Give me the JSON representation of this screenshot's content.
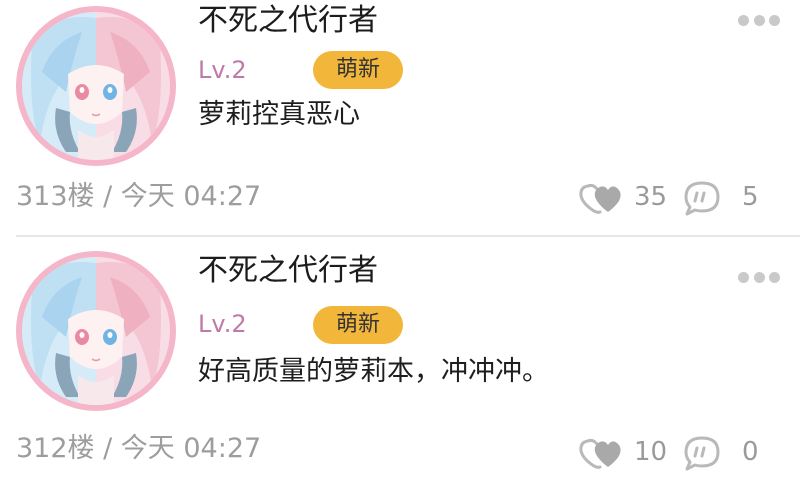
{
  "comments": [
    {
      "username": "不死之代行者",
      "level": "Lv.2",
      "badge": "萌新",
      "text": "萝莉控真恶心",
      "floor_time": "313楼 / 今天 04:27",
      "likes": "35",
      "replies": "5"
    },
    {
      "username": "不死之代行者",
      "level": "Lv.2",
      "badge": "萌新",
      "text": "好高质量的萝莉本，冲冲冲。",
      "floor_time": "312楼 / 今天 04:27",
      "likes": "10",
      "replies": "0"
    }
  ],
  "icons": {
    "like": "heart-like-icon",
    "reply": "comment-bubble-icon",
    "more": "more-dots-icon"
  },
  "colors": {
    "level": "#c17aa8",
    "badge": "#f2b73a",
    "avatar_ring": "#f4b6c8",
    "meta": "#9d9d9d"
  }
}
